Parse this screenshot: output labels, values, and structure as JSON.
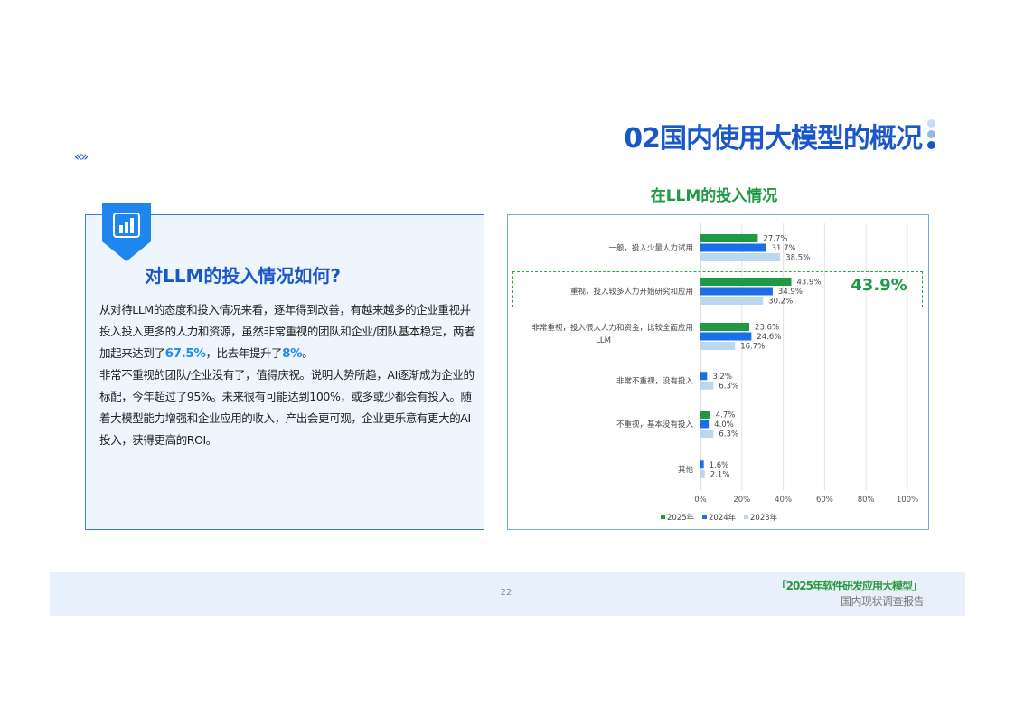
{
  "header": {
    "title": "02国内使用大模型的概况",
    "nav_icon": "double-chevron-icon",
    "accent_color": "#1a58c9"
  },
  "left_panel": {
    "badge_icon": "bar-chart-icon",
    "question": "对LLM的投入情况如何?",
    "paragraph1_a": "从对待LLM的态度和投入情况来看，逐年得到改善，有越来越多的企业重视并投入投入更多的人力和资源，虽然非常重视的团队和企业/团队基本稳定，两者加起来达到了",
    "paragraph1_hl1": "67.5%",
    "paragraph1_b": "，比去年提升了",
    "paragraph1_hl2": "8%",
    "paragraph1_c": "。",
    "paragraph2": "非常不重视的团队/企业没有了，值得庆祝。说明大势所趋，AI逐渐成为企业的标配，今年超过了95%。未来很有可能达到100%，或多或少都会有投入。随着大模型能力增强和企业应用的收入，产出会更可观，企业更乐意有更大的AI投入，获得更高的ROI。"
  },
  "callout": "43.9%",
  "footer": {
    "page_number": "22",
    "report_title": "「2025年软件研发应用大模型」",
    "report_subtitle": "国内现状调查报告"
  },
  "chart_data": {
    "type": "bar",
    "orientation": "horizontal",
    "title": "在LLM的投入情况",
    "categories": [
      "一般，投入少量人力试用",
      "重视，投入较多人力开始研究和应用",
      "非常重视，投入很大人力和资金，比较全面应用LLM",
      "非常不重视，没有投入",
      "不重视，基本没有投入",
      "其他"
    ],
    "series": [
      {
        "name": "2025年",
        "color": "#1f9a44",
        "values": [
          27.7,
          43.9,
          23.6,
          null,
          4.7,
          null
        ]
      },
      {
        "name": "2024年",
        "color": "#1a6fe8",
        "values": [
          31.7,
          34.9,
          24.6,
          3.2,
          4.0,
          1.6
        ]
      },
      {
        "name": "2023年",
        "color": "#bcd8f0",
        "values": [
          38.5,
          30.2,
          16.7,
          6.3,
          6.3,
          2.1
        ]
      }
    ],
    "xlim": [
      0,
      100
    ],
    "xticks": [
      "0%",
      "20%",
      "40%",
      "60%",
      "80%",
      "100%"
    ],
    "grid": true,
    "legend_position": "bottom-left",
    "highlighted_category": 1
  }
}
